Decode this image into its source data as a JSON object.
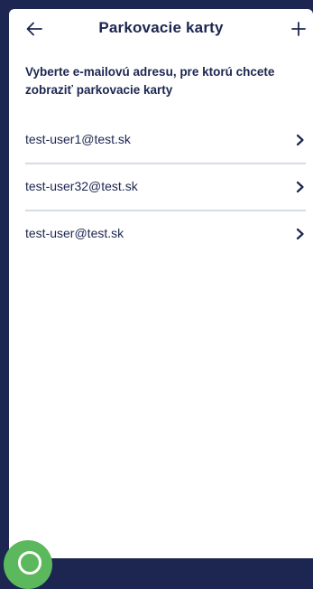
{
  "header": {
    "title": "Parkovacie karty",
    "back_icon": "arrow-left-icon",
    "add_icon": "plus-icon"
  },
  "instruction": "Vyberte e-mailovú adresu, pre ktorú chcete zobraziť parkovacie karty",
  "emails": [
    {
      "address": "test-user1@test.sk"
    },
    {
      "address": "test-user32@test.sk"
    },
    {
      "address": "test-user@test.sk"
    }
  ],
  "colors": {
    "brand_navy": "#1c2650",
    "divider": "#d6dbe6",
    "fab_green": "#5cb85c"
  }
}
